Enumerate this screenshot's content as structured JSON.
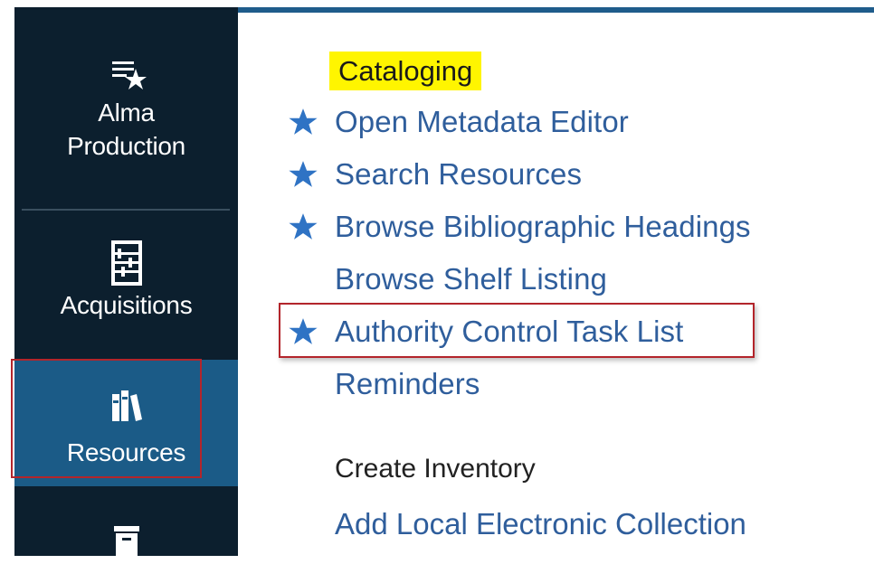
{
  "sidebar": {
    "items": [
      {
        "label_line1": "Alma",
        "label_line2": "Production",
        "icon": "list-star-icon"
      },
      {
        "label": "Acquisitions",
        "icon": "abacus-icon"
      },
      {
        "label": "Resources",
        "icon": "books-icon",
        "selected": true
      },
      {
        "label": "",
        "icon": "archive-box-icon"
      }
    ]
  },
  "main": {
    "section_title": "Cataloging",
    "items": [
      {
        "label": "Open Metadata Editor",
        "starred": true
      },
      {
        "label": "Search Resources",
        "starred": true
      },
      {
        "label": "Browse Bibliographic Headings",
        "starred": true
      },
      {
        "label": "Browse Shelf Listing",
        "starred": false
      },
      {
        "label": "Authority Control Task List",
        "starred": true
      },
      {
        "label": "Reminders",
        "starred": false
      }
    ],
    "group_title": "Create Inventory",
    "group_items": [
      {
        "label": "Add Local Electronic Collection"
      }
    ]
  },
  "colors": {
    "sidebar_bg": "#0c1f2e",
    "selected_bg": "#1b5b87",
    "link": "#2f5e9c",
    "star": "#2f73c4",
    "highlight": "#fff500",
    "annotation_red": "#b3252b"
  }
}
